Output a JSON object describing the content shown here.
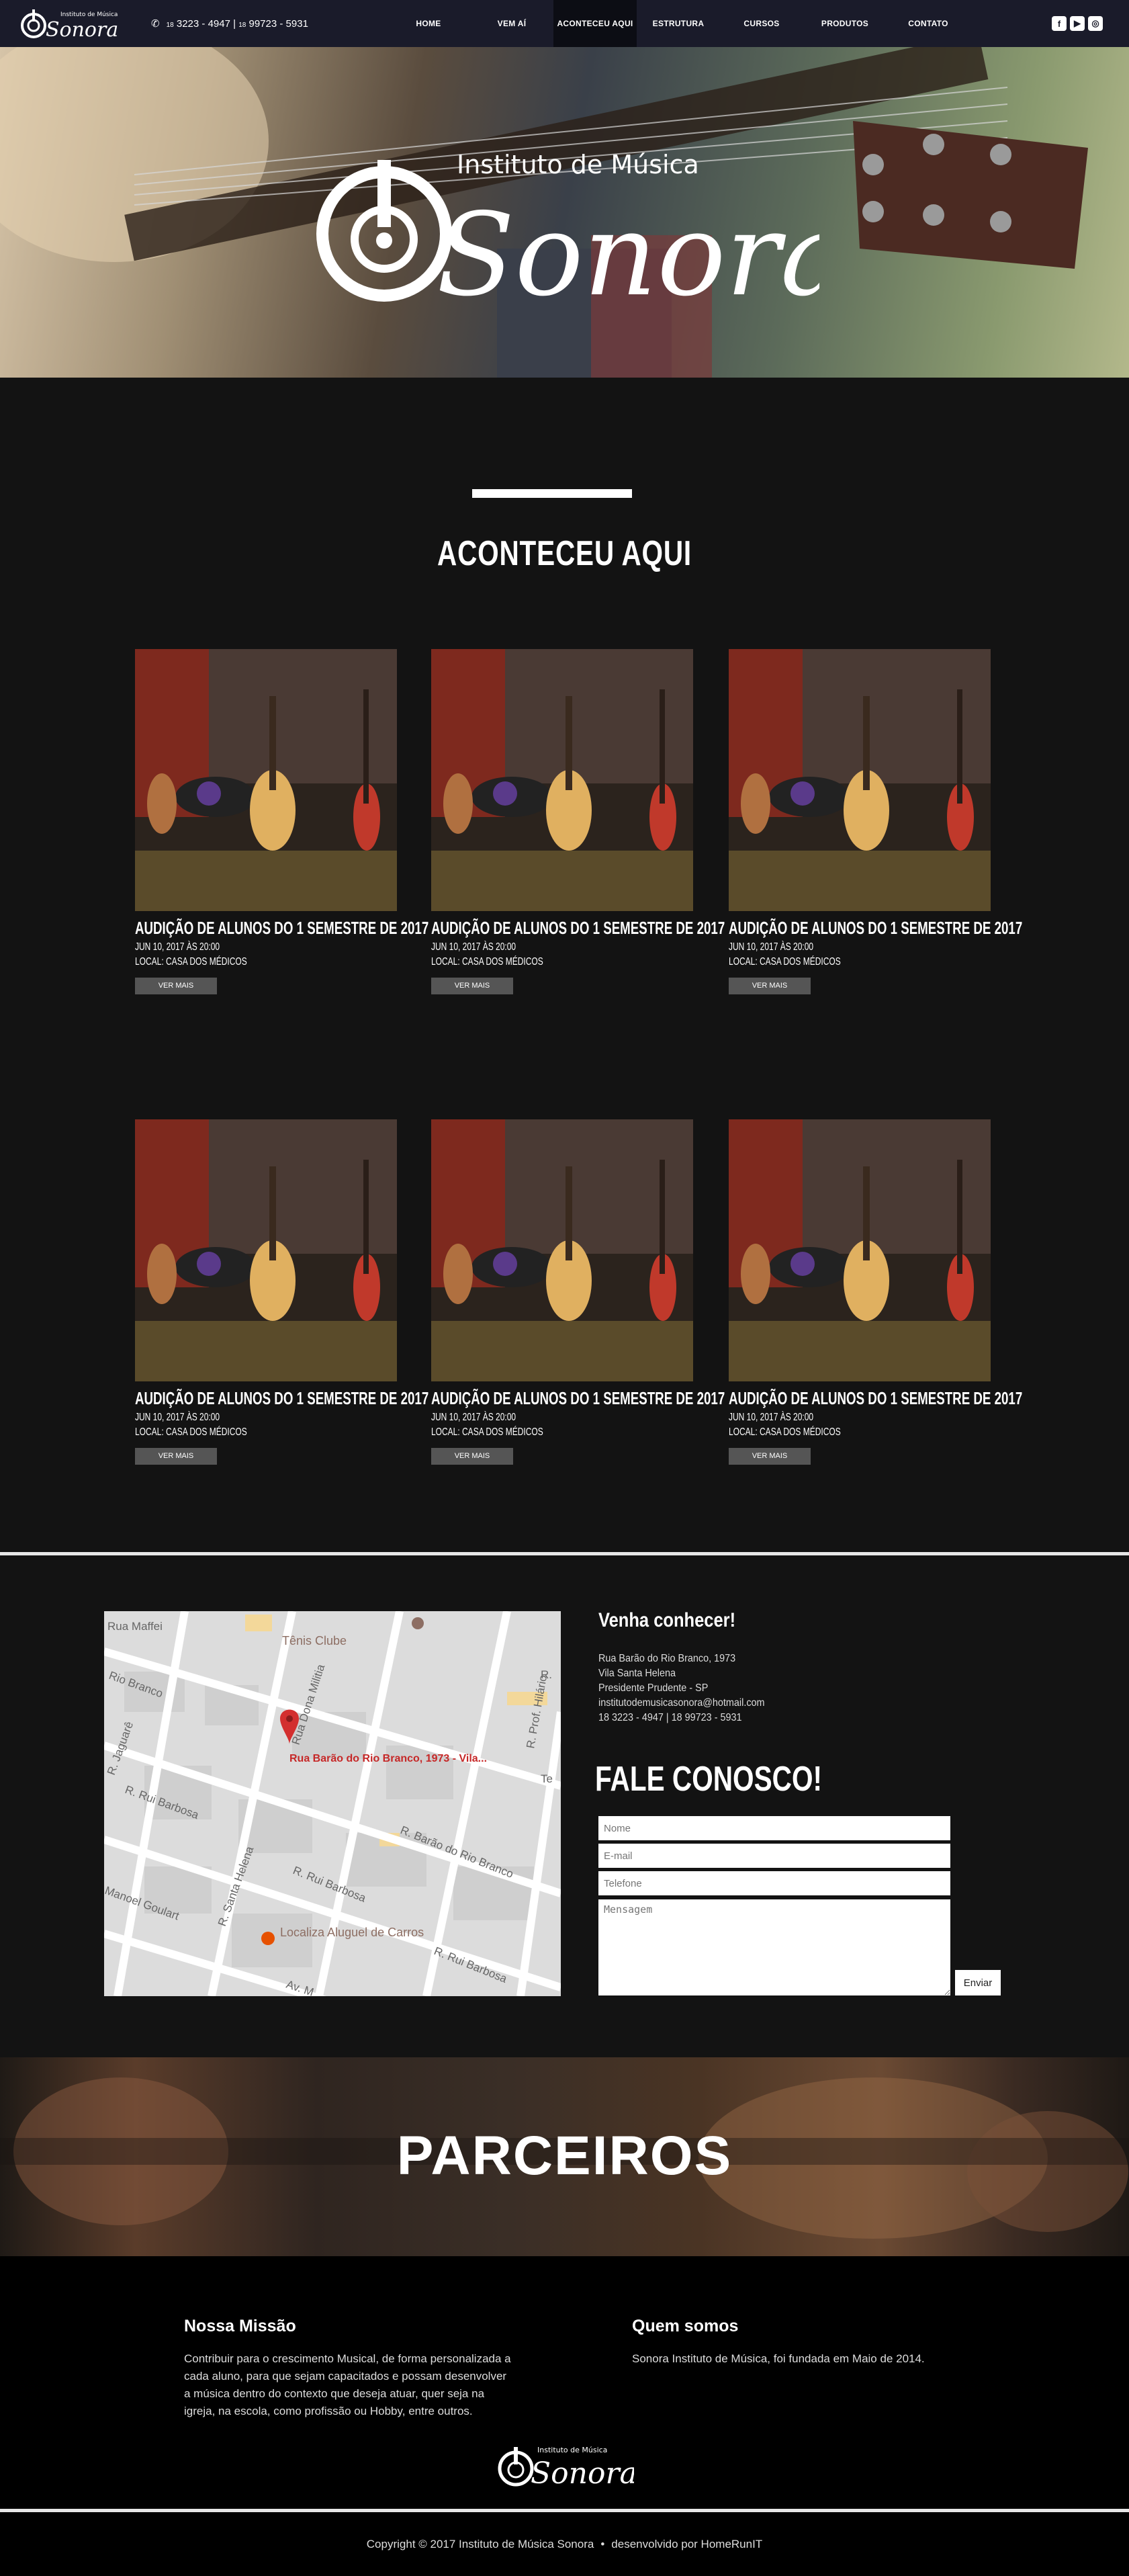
{
  "nav": {
    "logo_script": "Sonora",
    "logo_caption": "Instituto de Música",
    "phone_prefix_1": "18",
    "phone_1": "3223 - 4947",
    "phone_sep": "|",
    "phone_prefix_2": "18",
    "phone_2": "99723 - 5931",
    "menu": [
      "HOME",
      "VEM AÍ",
      "ACONTECEU AQUI",
      "ESTRUTURA",
      "CURSOS",
      "PRODUTOS",
      "CONTATO"
    ],
    "socials": [
      "facebook-icon",
      "youtube-icon",
      "instagram-icon"
    ]
  },
  "hero": {
    "logo_script": "Sonora",
    "logo_caption": "Instituto de Música"
  },
  "events": {
    "title": "ACONTECEU AQUI",
    "cards": [
      {
        "title": "AUDIÇÃO DE ALUNOS DO 1 SEMESTRE DE 2017",
        "date": "JUN 10, 2017 ÀS 20:00",
        "local": "LOCAL: CASA DOS MÉDICOS",
        "button": "VER MAIS"
      },
      {
        "title": "AUDIÇÃO DE ALUNOS DO 1 SEMESTRE DE 2017",
        "date": "JUN 10, 2017 ÀS 20:00",
        "local": "LOCAL: CASA DOS MÉDICOS",
        "button": "VER MAIS"
      },
      {
        "title": "AUDIÇÃO DE ALUNOS DO 1 SEMESTRE DE 2017",
        "date": "JUN 10, 2017 ÀS 20:00",
        "local": "LOCAL: CASA DOS MÉDICOS",
        "button": "VER MAIS"
      },
      {
        "title": "AUDIÇÃO DE ALUNOS DO 1 SEMESTRE DE 2017",
        "date": "JUN 10, 2017 ÀS 20:00",
        "local": "LOCAL: CASA DOS MÉDICOS",
        "button": "VER MAIS"
      },
      {
        "title": "AUDIÇÃO DE ALUNOS DO 1 SEMESTRE DE 2017",
        "date": "JUN 10, 2017 ÀS 20:00",
        "local": "LOCAL: CASA DOS MÉDICOS",
        "button": "VER MAIS"
      },
      {
        "title": "AUDIÇÃO DE ALUNOS DO 1 SEMESTRE DE 2017",
        "date": "JUN 10, 2017 ÀS 20:00",
        "local": "LOCAL: CASA DOS MÉDICOS",
        "button": "VER MAIS"
      }
    ]
  },
  "map": {
    "labels": {
      "maffei": "Rua Maffei",
      "tenis": "Tênis Clube",
      "rio_branco": "Rio Branco",
      "dona_mililia": "Rua Dona Militia",
      "jaguare": "R. Jaguarê",
      "rui_barbosa_1": "R. Rui Barbosa",
      "rui_barbosa_2": "R. Rui Barbosa",
      "rui_barbosa_3": "R. Rui Barbosa",
      "barao_rio_branco": "R. Barão do Rio Branco",
      "santa_helena": "R. Santa Helena",
      "manoel_goulart": "Manoel Goulart",
      "prof_hilario": "R. Prof. Hilário",
      "av": "Av. M",
      "r": "R.",
      "te": "Te",
      "pin_label": "Rua Barão do Rio Branco, 1973 - Vila...",
      "localiza": "Localiza Aluguel de Carros"
    }
  },
  "contact": {
    "visit_title": "Venha conhecer!",
    "address_lines": [
      "Rua Barão do Rio Branco, 1973",
      "Vila Santa Helena",
      "Presidente Prudente - SP",
      "institutodemusicasonora@hotmail.com",
      "18 3223 - 4947 | 18 99723 - 5931"
    ],
    "form_title": "FALE CONOSCO!",
    "placeholders": {
      "name": "Nome",
      "email": "E-mail",
      "phone": "Telefone",
      "message": "Mensagem"
    },
    "send": "Enviar"
  },
  "partners": {
    "title": "PARCEIROS"
  },
  "footer": {
    "mission_title": "Nossa Missão",
    "mission_text": "Contribuir para o crescimento Musical, de forma personalizada a cada aluno, para que sejam capacitados e possam desenvolver a música dentro do contexto que deseja atuar, quer seja na igreja, na escola, como profissão ou Hobby, entre outros.",
    "about_title": "Quem somos",
    "about_text": "Sonora Instituto de Música, foi fundada em Maio de 2014.",
    "logo_script": "Sonora",
    "logo_caption": "Instituto de Música",
    "copyright": "Copyright © 2017 Instituto de Música Sonora",
    "bullet": "•",
    "credit": "desenvolvido por HomeRunIT"
  },
  "colors": {
    "nav_bg": "#1a1b2a",
    "page_bg": "#131313",
    "button_gray": "#555555",
    "map_pin": "#d32f2f"
  }
}
